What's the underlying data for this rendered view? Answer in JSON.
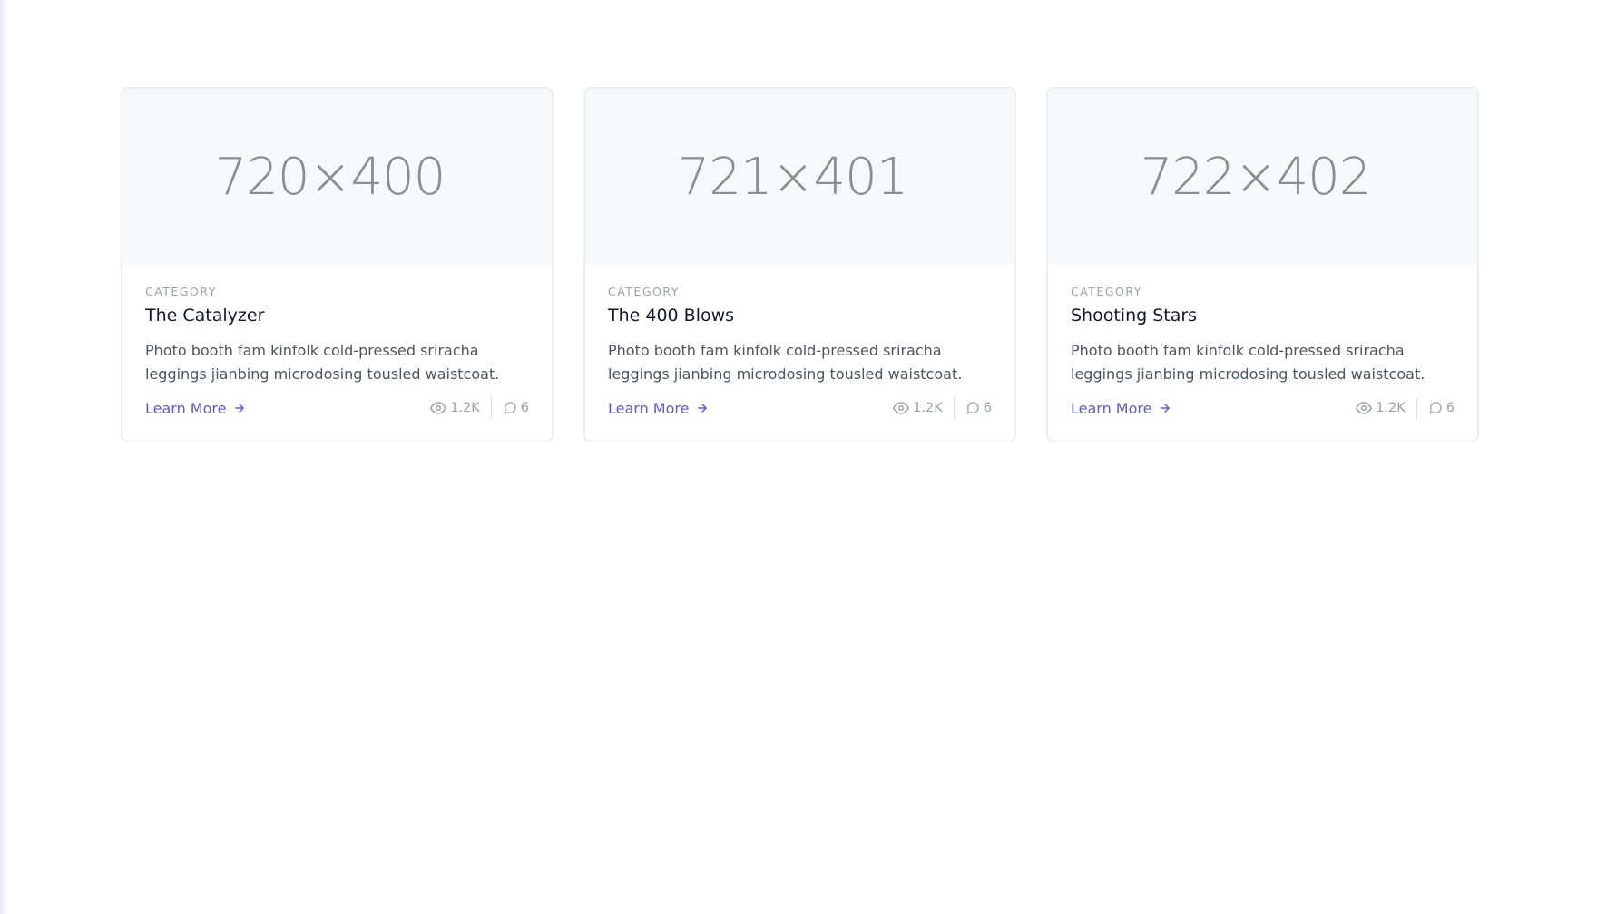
{
  "cards": [
    {
      "image_label": "720×400",
      "category": "CATEGORY",
      "title": "The Catalyzer",
      "description": "Photo booth fam kinfolk cold-pressed sriracha leggings jianbing microdosing tousled waistcoat.",
      "link_label": "Learn More",
      "views": "1.2K",
      "comments": "6"
    },
    {
      "image_label": "721×401",
      "category": "CATEGORY",
      "title": "The 400 Blows",
      "description": "Photo booth fam kinfolk cold-pressed sriracha leggings jianbing microdosing tousled waistcoat.",
      "link_label": "Learn More",
      "views": "1.2K",
      "comments": "6"
    },
    {
      "image_label": "722×402",
      "category": "CATEGORY",
      "title": "Shooting Stars",
      "description": "Photo booth fam kinfolk cold-pressed sriracha leggings jianbing microdosing tousled waistcoat.",
      "link_label": "Learn More",
      "views": "1.2K",
      "comments": "6"
    }
  ],
  "icons": {
    "arrow": "arrow-right-icon",
    "views": "eye-icon",
    "comments": "chat-bubble-icon"
  },
  "colors": {
    "accent": "#5b5bd6",
    "muted": "#9aa0aa",
    "title": "#111827",
    "body": "#4b5563",
    "image_bg": "#f7f8fa"
  }
}
